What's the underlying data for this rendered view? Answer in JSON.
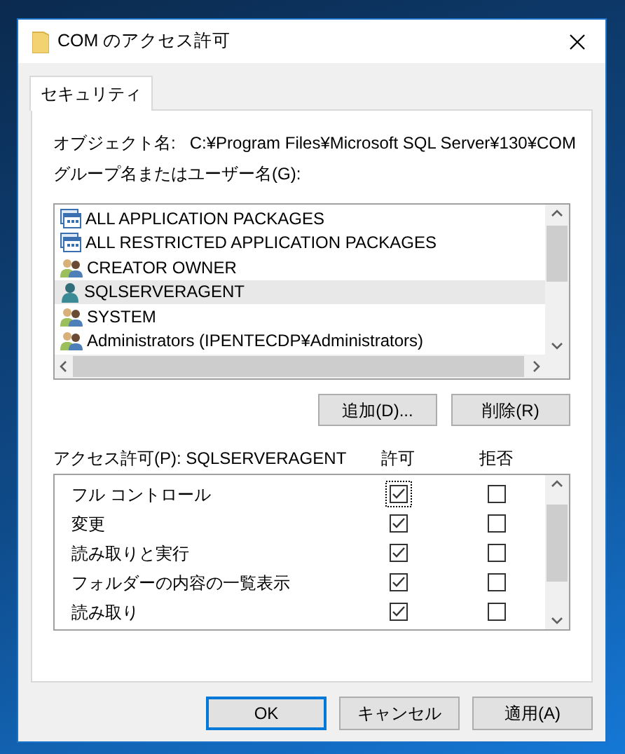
{
  "window": {
    "title": "COM のアクセス許可"
  },
  "tabs": [
    {
      "label": "セキュリティ",
      "selected": true
    }
  ],
  "object_name": {
    "label": "オブジェクト名:",
    "value": "C:¥Program Files¥Microsoft SQL Server¥130¥COM"
  },
  "principals": {
    "label": "グループ名またはユーザー名(G):",
    "items": [
      {
        "name": "ALL APPLICATION PACKAGES",
        "kind": "package",
        "selected": false
      },
      {
        "name": "ALL RESTRICTED APPLICATION PACKAGES",
        "kind": "package",
        "selected": false
      },
      {
        "name": "CREATOR OWNER",
        "kind": "group",
        "selected": false
      },
      {
        "name": "SQLSERVERAGENT",
        "kind": "user",
        "selected": true
      },
      {
        "name": "SYSTEM",
        "kind": "group",
        "selected": false
      },
      {
        "name": "Administrators (IPENTECDP¥Administrators)",
        "kind": "group",
        "selected": false
      }
    ],
    "buttons": [
      "追加(D)...",
      "削除(R)"
    ]
  },
  "permissions": {
    "label": "アクセス許可(P): SQLSERVERAGENT",
    "allow_heading": "許可",
    "deny_heading": "拒否",
    "rows": [
      {
        "name": "フル コントロール",
        "allow": true,
        "deny": false,
        "focused": true
      },
      {
        "name": "変更",
        "allow": true,
        "deny": false,
        "focused": false
      },
      {
        "name": "読み取りと実行",
        "allow": true,
        "deny": false,
        "focused": false
      },
      {
        "name": "フォルダーの内容の一覧表示",
        "allow": true,
        "deny": false,
        "focused": false
      },
      {
        "name": "読み取り",
        "allow": true,
        "deny": false,
        "focused": false
      }
    ]
  },
  "buttons": [
    {
      "label": "OK",
      "default": true
    },
    {
      "label": "キャンセル",
      "default": false
    },
    {
      "label": "適用(A)",
      "default": false
    }
  ]
}
